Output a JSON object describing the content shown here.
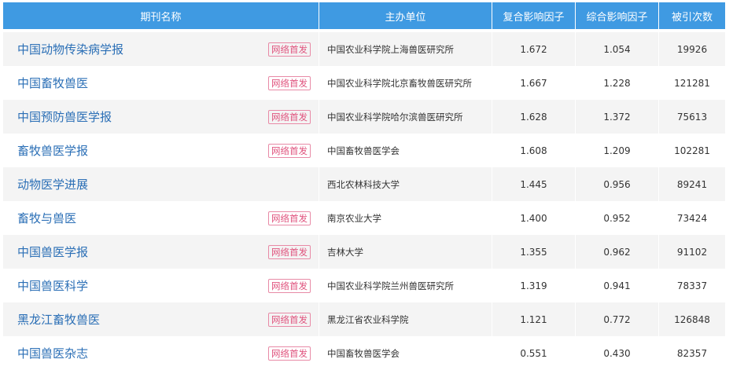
{
  "headers": {
    "name": "期刊名称",
    "sponsor": "主办单位",
    "composite_if": "复合影响因子",
    "comprehensive_if": "综合影响因子",
    "citations": "被引次数"
  },
  "rows": [
    {
      "name": "中国动物传染病学报",
      "badge": "网络首发",
      "sponsor": "中国农业科学院上海兽医研究所",
      "composite_if": "1.672",
      "comprehensive_if": "1.054",
      "citations": "19926"
    },
    {
      "name": "中国畜牧兽医",
      "badge": "网络首发",
      "sponsor": "中国农业科学院北京畜牧兽医研究所",
      "composite_if": "1.667",
      "comprehensive_if": "1.228",
      "citations": "121281"
    },
    {
      "name": "中国预防兽医学报",
      "badge": "网络首发",
      "sponsor": "中国农业科学院哈尔滨兽医研究所",
      "composite_if": "1.628",
      "comprehensive_if": "1.372",
      "citations": "75613"
    },
    {
      "name": "畜牧兽医学报",
      "badge": "网络首发",
      "sponsor": "中国畜牧兽医学会",
      "composite_if": "1.608",
      "comprehensive_if": "1.209",
      "citations": "102281"
    },
    {
      "name": "动物医学进展",
      "badge": "",
      "sponsor": "西北农林科技大学",
      "composite_if": "1.445",
      "comprehensive_if": "0.956",
      "citations": "89241"
    },
    {
      "name": "畜牧与兽医",
      "badge": "网络首发",
      "sponsor": "南京农业大学",
      "composite_if": "1.400",
      "comprehensive_if": "0.952",
      "citations": "73424"
    },
    {
      "name": "中国兽医学报",
      "badge": "网络首发",
      "sponsor": "吉林大学",
      "composite_if": "1.355",
      "comprehensive_if": "0.962",
      "citations": "91102"
    },
    {
      "name": "中国兽医科学",
      "badge": "网络首发",
      "sponsor": "中国农业科学院兰州兽医研究所",
      "composite_if": "1.319",
      "comprehensive_if": "0.941",
      "citations": "78337"
    },
    {
      "name": "黑龙江畜牧兽医",
      "badge": "网络首发",
      "sponsor": "黑龙江省农业科学院",
      "composite_if": "1.121",
      "comprehensive_if": "0.772",
      "citations": "126848"
    },
    {
      "name": "中国兽医杂志",
      "badge": "网络首发",
      "sponsor": "中国畜牧兽医学会",
      "composite_if": "0.551",
      "comprehensive_if": "0.430",
      "citations": "82357"
    }
  ]
}
